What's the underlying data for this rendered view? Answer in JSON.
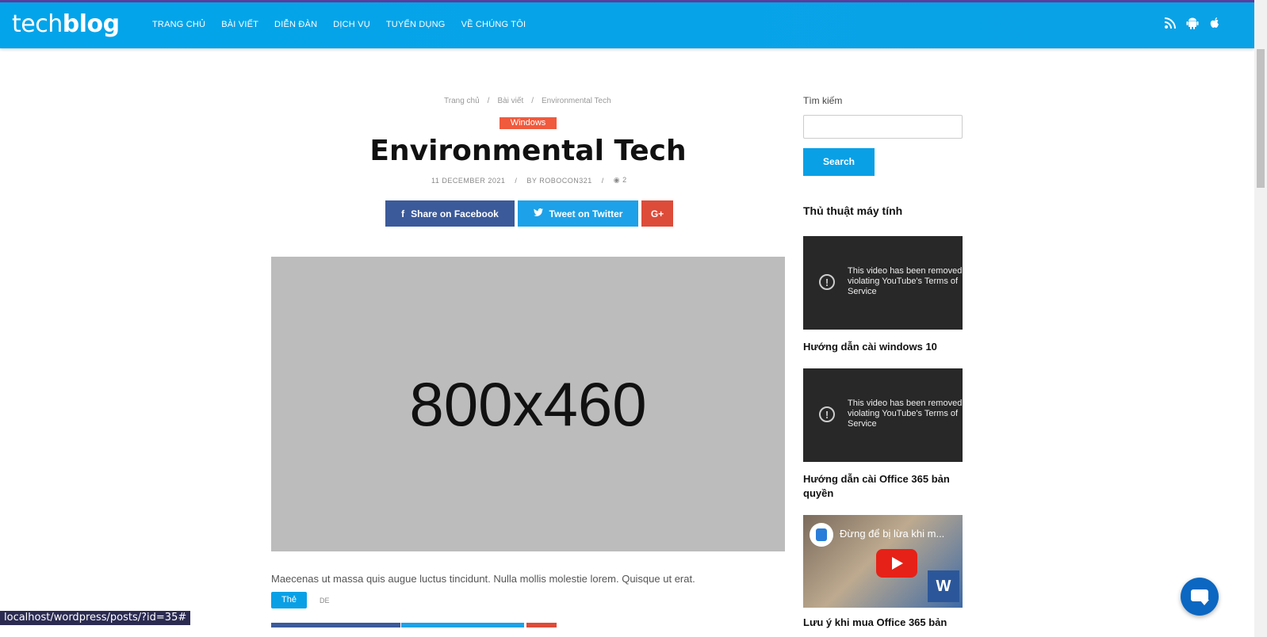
{
  "header": {
    "logo_light": "tech",
    "logo_bold": "blog",
    "nav": [
      "TRANG CHỦ",
      "BÀI VIẾT",
      "DIỄN ĐÀN",
      "DỊCH VỤ",
      "TUYỂN DỤNG",
      "VỀ CHÚNG TÔI"
    ],
    "icons": [
      "rss-icon",
      "android-icon",
      "apple-icon"
    ]
  },
  "breadcrumb": [
    "Trang chủ",
    "Bài viết",
    "Environmental Tech"
  ],
  "post": {
    "category": "Windows",
    "title": "Environmental Tech",
    "date": "11 DECEMBER 2021",
    "author": "BY ROBOCON321",
    "views": "2",
    "share_facebook": "Share on Facebook",
    "share_twitter": "Tweet on Twitter",
    "share_gplus": "G+",
    "image_text": "800x460",
    "excerpt": "Maecenas ut massa quis augue luctus tincidunt. Nulla mollis molestie lorem. Quisque ut erat.",
    "tag_active": "Thẻ",
    "tag_other": "DE"
  },
  "sidebar": {
    "search_label": "Tìm kiếm",
    "search_button": "Search",
    "section_title": "Thủ thuật máy tính",
    "videos": [
      {
        "message": "This video has been removed\nviolating YouTube's Terms of\nService",
        "title": "Hướng dẫn cài windows 10"
      },
      {
        "message": "This video has been removed\nviolating YouTube's Terms of\nService",
        "title": "Hướng dẫn cài Office 365 bản quyền"
      },
      {
        "overlay_text": "Đừng để bị lừa khi m...",
        "title": "Lưu ý khi mua Office 365 bản"
      }
    ]
  },
  "status_url": "localhost/wordpress/posts/?id=35#",
  "colors": {
    "header": "#03a4ea",
    "badge": "#f05a3d",
    "facebook": "#3b5a9a",
    "twitter": "#1da1e8",
    "gplus": "#dd4b39"
  }
}
